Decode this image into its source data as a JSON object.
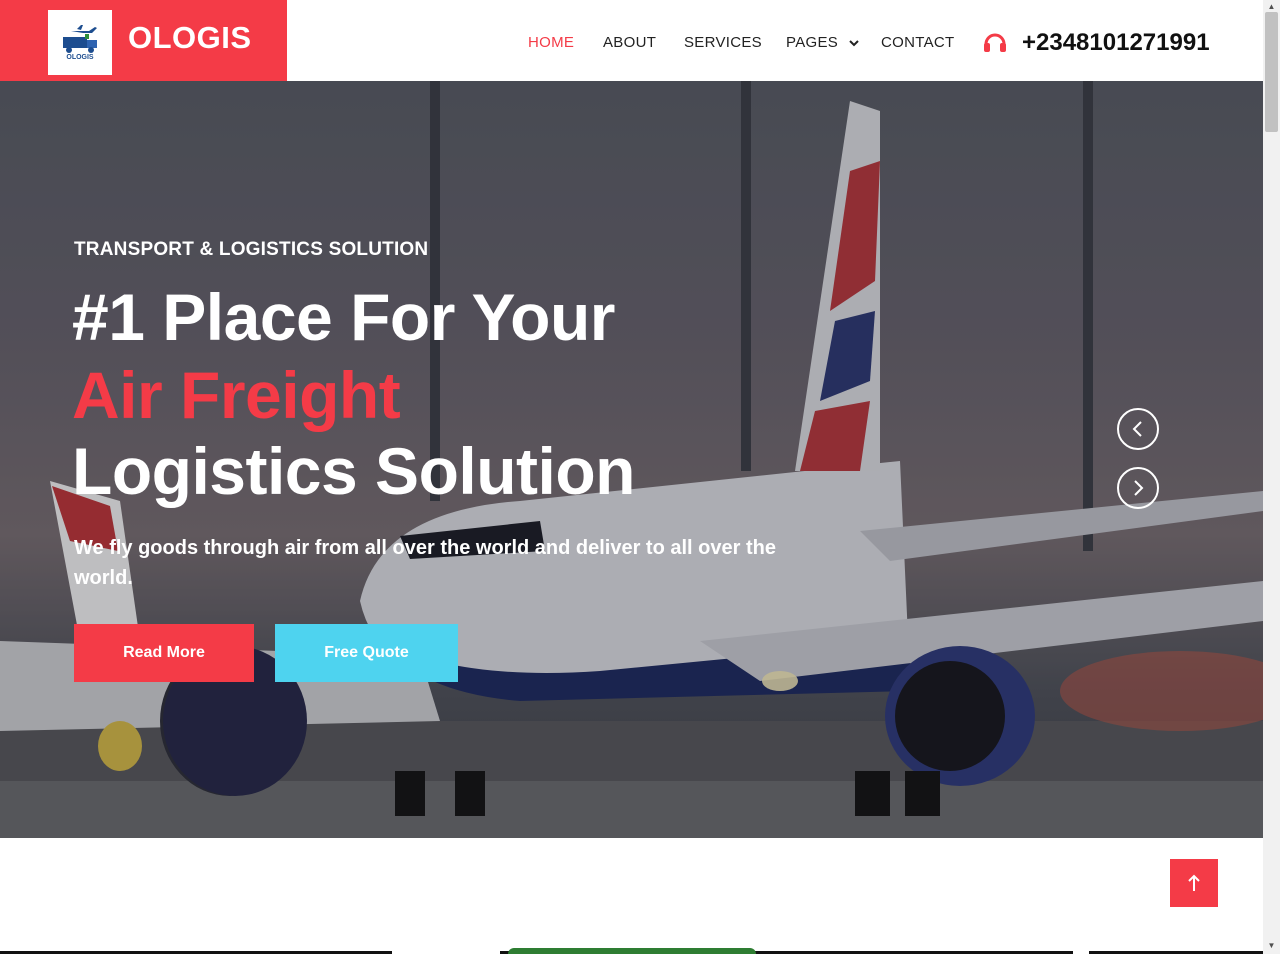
{
  "brand": {
    "name": "OLOGIS",
    "logo_text": "OLOGIS"
  },
  "nav": {
    "items": [
      {
        "label": "HOME",
        "active": true
      },
      {
        "label": "ABOUT"
      },
      {
        "label": "SERVICES"
      },
      {
        "label": "PAGES",
        "has_dropdown": true
      },
      {
        "label": "CONTACT"
      }
    ],
    "phone_icon": "headphones-icon",
    "phone_number": "+2348101271991"
  },
  "hero": {
    "kicker": "TRANSPORT & LOGISTICS SOLUTION",
    "heading_line1": "#1 Place For Your",
    "heading_line2": "Air Freight",
    "heading_line3": "Logistics Solution",
    "lead": "We fly goods through air from all over the world and deliver to all over the world.",
    "read_more": "Read More",
    "free_quote": "Free Quote",
    "prev_icon": "chevron-left-icon",
    "next_icon": "chevron-right-icon"
  },
  "back_to_top_icon": "arrow-up-icon",
  "colors": {
    "accent": "#f43b47",
    "secondary": "#4ed3ef"
  }
}
